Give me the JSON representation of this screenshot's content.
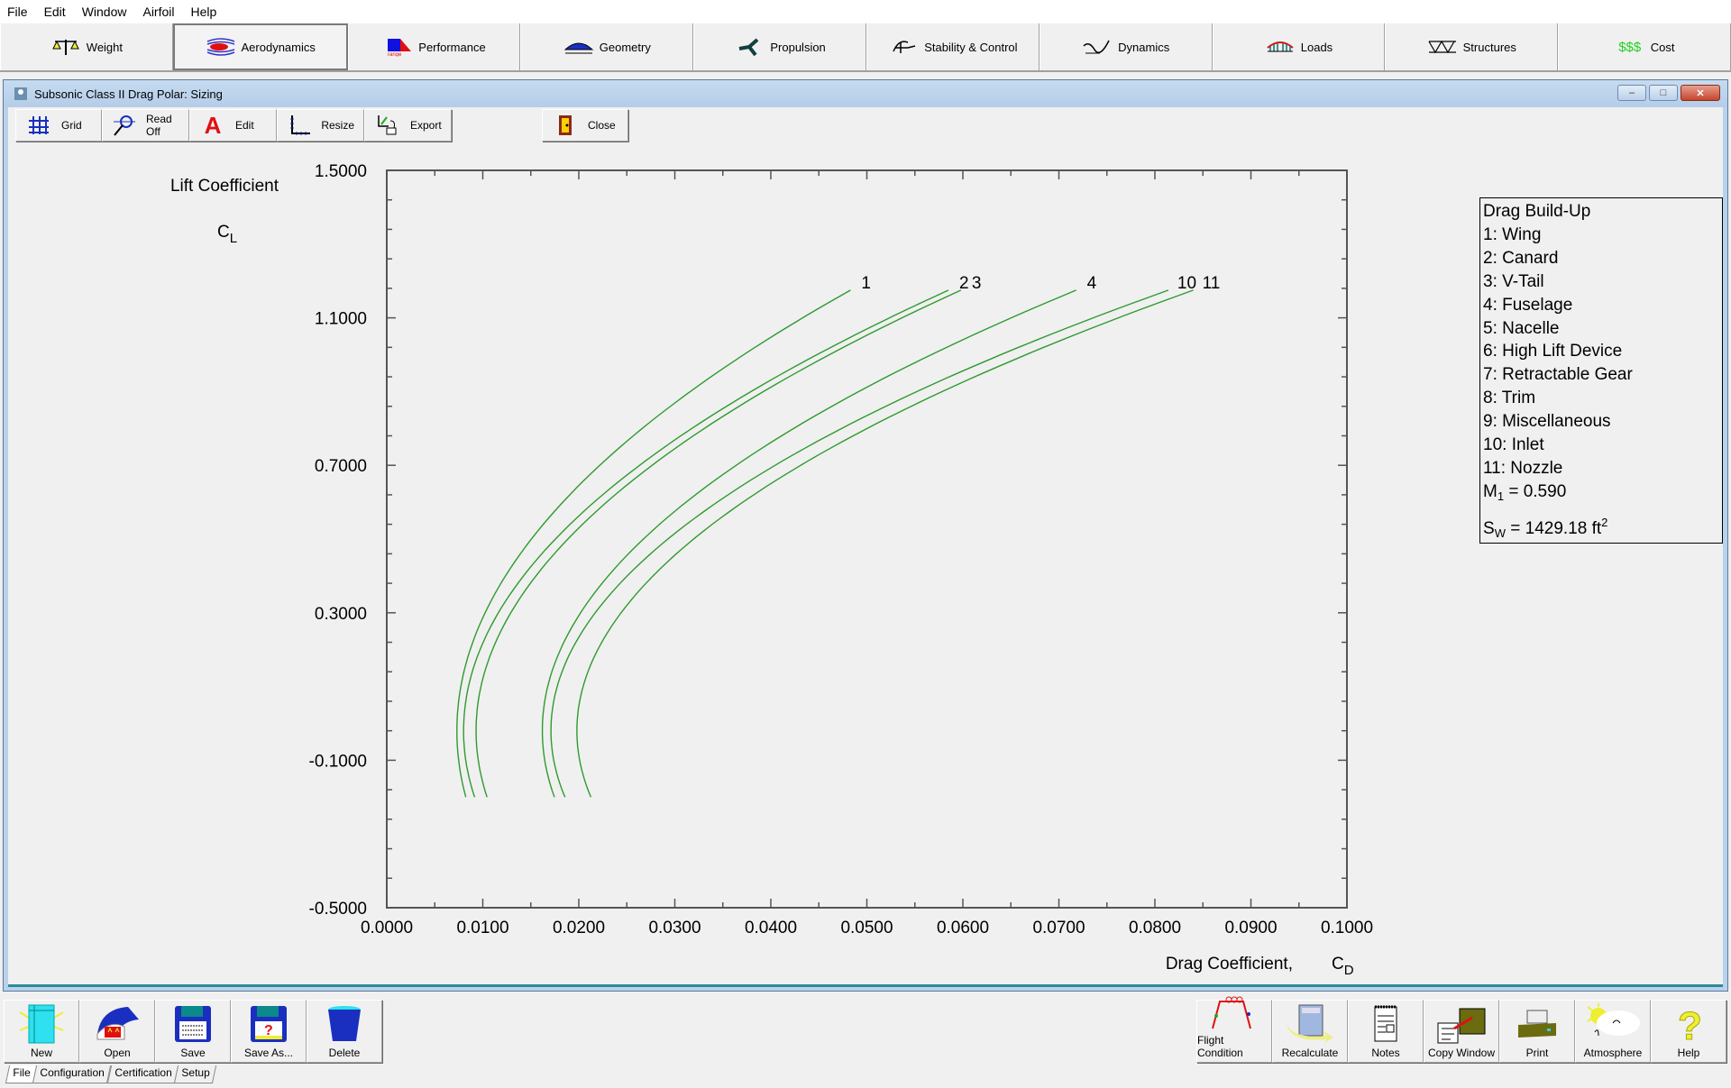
{
  "menu": [
    "File",
    "Edit",
    "Window",
    "Airfoil",
    "Help"
  ],
  "modules": [
    {
      "label": "Weight",
      "icon": "scale-icon",
      "active": false
    },
    {
      "label": "Aerodynamics",
      "icon": "airflow-icon",
      "active": true
    },
    {
      "label": "Performance",
      "icon": "range-icon",
      "active": false
    },
    {
      "label": "Geometry",
      "icon": "wing-planform-icon",
      "active": false
    },
    {
      "label": "Propulsion",
      "icon": "propeller-icon",
      "active": false
    },
    {
      "label": "Stability & Control",
      "icon": "stability-icon",
      "active": false
    },
    {
      "label": "Dynamics",
      "icon": "dynamics-icon",
      "active": false
    },
    {
      "label": "Loads",
      "icon": "loads-icon",
      "active": false
    },
    {
      "label": "Structures",
      "icon": "truss-icon",
      "active": false
    },
    {
      "label": "Cost",
      "icon": "dollar-icon",
      "active": false,
      "icon_text": "$$$"
    }
  ],
  "window": {
    "title": "Subsonic Class II Drag Polar: Sizing",
    "controls": {
      "minimize": "–",
      "maximize": "□",
      "close": "✕"
    }
  },
  "chart_toolbar": [
    {
      "label": "Grid",
      "icon": "grid-icon"
    },
    {
      "label": "Read Off",
      "icon": "read-off-icon"
    },
    {
      "label": "Edit",
      "icon": "edit-text-icon"
    },
    {
      "label": "Resize",
      "icon": "resize-axes-icon"
    },
    {
      "label": "Export",
      "icon": "export-icon"
    },
    {
      "label": "Close",
      "icon": "door-icon"
    }
  ],
  "legend": {
    "title": "Drag Build-Up",
    "items": [
      "1:  Wing",
      "2:  Canard",
      "3:  V-Tail",
      "4:  Fuselage",
      "5:  Nacelle",
      "6:  High Lift Device",
      "7:  Retractable Gear",
      "8:  Trim",
      "9:  Miscellaneous",
      "10:  Inlet",
      "11:  Nozzle"
    ],
    "mach_label": "M",
    "mach_sub": "1",
    "mach_value": " = 0.590",
    "area_label": "S",
    "area_sub": "W",
    "area_value": " = 1429.18 ft",
    "area_sup": "2"
  },
  "chart_data": {
    "type": "line",
    "title": "",
    "xlabel": "Drag Coefficient,",
    "xlabel_symbol": "C",
    "xlabel_sub": "D",
    "ylabel": "Lift Coefficient",
    "ylabel_symbol": "C",
    "ylabel_sub": "L",
    "xlim": [
      0.0,
      0.1
    ],
    "ylim": [
      -0.5,
      1.5
    ],
    "xticks": [
      "0.0000",
      "0.0100",
      "0.0200",
      "0.0300",
      "0.0400",
      "0.0500",
      "0.0600",
      "0.0700",
      "0.0800",
      "0.0900",
      "0.1000"
    ],
    "yticks": [
      "-0.5000",
      "-0.1000",
      "0.3000",
      "0.7000",
      "1.1000",
      "1.5000"
    ],
    "ytick_values": [
      -0.5,
      -0.1,
      0.3,
      0.7,
      1.1,
      1.5
    ],
    "grid": false,
    "line_color": "#2e9a2e",
    "cl_range": [
      -0.2,
      1.175
    ],
    "series": [
      {
        "name": "1",
        "cd_min": 0.0073,
        "cl_at_cd_min": -0.02,
        "cd_at_top": 0.0483
      },
      {
        "name": "2",
        "cd_min": 0.008,
        "cl_at_cd_min": -0.02,
        "cd_at_top": 0.0585
      },
      {
        "name": "3",
        "cd_min": 0.0093,
        "cl_at_cd_min": -0.02,
        "cd_at_top": 0.0598
      },
      {
        "name": "4",
        "cd_min": 0.0162,
        "cl_at_cd_min": -0.02,
        "cd_at_top": 0.0718
      },
      {
        "name": "10",
        "cd_min": 0.0171,
        "cl_at_cd_min": -0.02,
        "cd_at_top": 0.0814
      },
      {
        "name": "11",
        "cd_min": 0.0198,
        "cl_at_cd_min": -0.02,
        "cd_at_top": 0.084
      }
    ]
  },
  "bottom_left": [
    {
      "label": "New",
      "icon": "new-sheet-icon"
    },
    {
      "label": "Open",
      "icon": "open-hangar-icon"
    },
    {
      "label": "Save",
      "icon": "floppy-save-icon"
    },
    {
      "label": "Save As...",
      "icon": "floppy-save-as-icon"
    },
    {
      "label": "Delete",
      "icon": "trash-bin-icon"
    }
  ],
  "bottom_right": [
    {
      "label": "Flight Condition",
      "icon": "flight-profile-icon"
    },
    {
      "label": "Recalculate",
      "icon": "calculator-icon"
    },
    {
      "label": "Notes",
      "icon": "notepad-icon"
    },
    {
      "label": "Copy Window",
      "icon": "copy-window-icon"
    },
    {
      "label": "Print",
      "icon": "printer-icon"
    },
    {
      "label": "Atmosphere",
      "icon": "atmosphere-icon"
    },
    {
      "label": "Help",
      "icon": "question-icon"
    }
  ],
  "bottom_tabs": [
    "File",
    "Configuration",
    "Certification",
    "Setup"
  ]
}
